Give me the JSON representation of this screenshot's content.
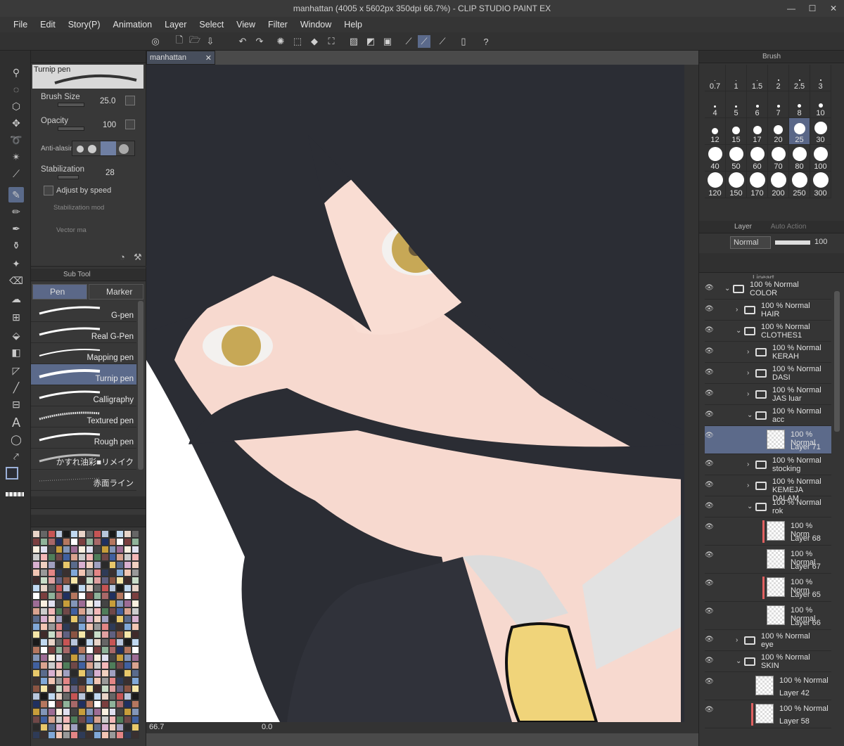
{
  "window": {
    "title": "manhattan (4005 x 5602px 350dpi 66.7%) - CLIP STUDIO PAINT EX",
    "minimize": "—",
    "maximize": "☐",
    "close": "✕"
  },
  "menu": [
    "File",
    "Edit",
    "Story(P)",
    "Animation",
    "Layer",
    "Select",
    "View",
    "Filter",
    "Window",
    "Help"
  ],
  "tool_property": {
    "brush_name": "Turnip pen",
    "brush_size_label": "Brush Size",
    "brush_size_value": "25.0",
    "opacity_label": "Opacity",
    "opacity_value": "100",
    "antialias_label": "Anti-alasing",
    "stabilization_label": "Stabilization",
    "stabilization_value": "28",
    "adjust_speed_label": "Adjust by speed",
    "stab_mode_label": "Stabilization mod",
    "vector_label": "Vector ma"
  },
  "sub_tool": {
    "title": "Sub Tool",
    "tabs": [
      "Pen",
      "Marker"
    ],
    "brushes": [
      "G-pen",
      "Real G-Pen",
      "Mapping pen",
      "Turnip pen",
      "Calligraphy",
      "Textured pen",
      "Rough pen",
      "かすれ油彩■リメイク",
      "赤面ライン"
    ],
    "selected": "Turnip pen"
  },
  "canvas": {
    "tab": "manhattan",
    "zoom": "66.7",
    "rotation": "0.0"
  },
  "brush_size_panel": {
    "tab": "Brush",
    "sizes": [
      "0.7",
      "1",
      "1.5",
      "2",
      "2.5",
      "3",
      "4",
      "5",
      "6",
      "7",
      "8",
      "10",
      "12",
      "15",
      "17",
      "20",
      "25",
      "30",
      "40",
      "50",
      "60",
      "70",
      "80",
      "100",
      "120",
      "150",
      "170",
      "200",
      "250",
      "300"
    ],
    "selected": "25"
  },
  "layer_panel": {
    "tabs": [
      "Layer",
      "Auto Action"
    ],
    "blend_mode": "Normal",
    "opacity": "100",
    "partial_top": "Lineart",
    "layers": [
      {
        "pct": "100 % Normal",
        "name": "COLOR",
        "type": "folder",
        "depth": 0,
        "open": true
      },
      {
        "pct": "100 % Normal",
        "name": "HAIR",
        "type": "folder",
        "depth": 1,
        "open": false
      },
      {
        "pct": "100 % Normal",
        "name": "CLOTHES1",
        "type": "folder",
        "depth": 1,
        "open": true
      },
      {
        "pct": "100 % Normal",
        "name": "KERAH",
        "type": "folder",
        "depth": 2,
        "open": false
      },
      {
        "pct": "100 % Normal",
        "name": "DASI",
        "type": "folder",
        "depth": 2,
        "open": false
      },
      {
        "pct": "100 % Normal",
        "name": "JAS luar",
        "type": "folder",
        "depth": 2,
        "open": false
      },
      {
        "pct": "100 % Normal",
        "name": "acc",
        "type": "folder",
        "depth": 2,
        "open": true
      },
      {
        "pct": "100 % Normal",
        "name": "Layer 71",
        "type": "layer",
        "depth": 3,
        "selected": true
      },
      {
        "pct": "100 % Normal",
        "name": "stocking",
        "type": "folder",
        "depth": 2,
        "open": false
      },
      {
        "pct": "100 % Normal",
        "name": "KEMEJA DALAM",
        "type": "folder",
        "depth": 2,
        "open": false
      },
      {
        "pct": "100 % Normal",
        "name": "rok",
        "type": "folder",
        "depth": 2,
        "open": true
      },
      {
        "pct": "100 % Norm",
        "name": "Layer 68",
        "type": "layer",
        "depth": 3,
        "clip": true
      },
      {
        "pct": "100 % Normal",
        "name": "Layer 67",
        "type": "layer",
        "depth": 3
      },
      {
        "pct": "100 % Norm",
        "name": "Layer 65",
        "type": "layer",
        "depth": 3,
        "clip": true
      },
      {
        "pct": "100 % Normal",
        "name": "Layer 66",
        "type": "layer",
        "depth": 3
      },
      {
        "pct": "100 % Normal",
        "name": "eye",
        "type": "folder",
        "depth": 1,
        "open": false
      },
      {
        "pct": "100 % Normal",
        "name": "SKIN",
        "type": "folder",
        "depth": 1,
        "open": true
      },
      {
        "pct": "100 % Normal",
        "name": "Layer 42",
        "type": "layer",
        "depth": 2
      },
      {
        "pct": "100 % Normal",
        "name": "Layer 58",
        "type": "layer",
        "depth": 2,
        "clip": true
      }
    ]
  },
  "colors": {
    "accent": "#5b6a8b",
    "hair": "#2b2d34",
    "skin": "#f7d9cf",
    "tie": "#f0d47a"
  }
}
